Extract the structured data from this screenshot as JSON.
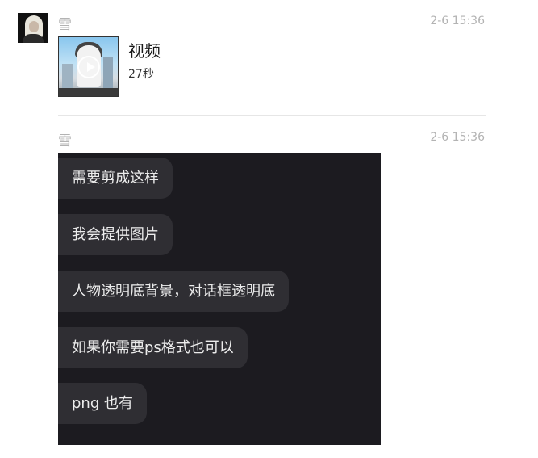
{
  "messages": [
    {
      "sender": "雪",
      "time": "2-6 15:36",
      "video": {
        "title": "视频",
        "duration": "27秒",
        "play_icon": "play-circle-icon"
      }
    },
    {
      "sender": "雪",
      "time": "2-6 15:36",
      "screenshot": {
        "bubbles": [
          "需要剪成这样",
          "我会提供图片",
          "人物透明底背景，对话框透明底",
          "如果你需要ps格式也可以",
          "png 也有"
        ]
      }
    }
  ],
  "colors": {
    "background": "#ffffff",
    "meta_text": "#b3b3b3",
    "screenshot_bg": "#1c1b20",
    "bubble_bg": "#2f2e33",
    "bubble_text": "#ececec"
  }
}
